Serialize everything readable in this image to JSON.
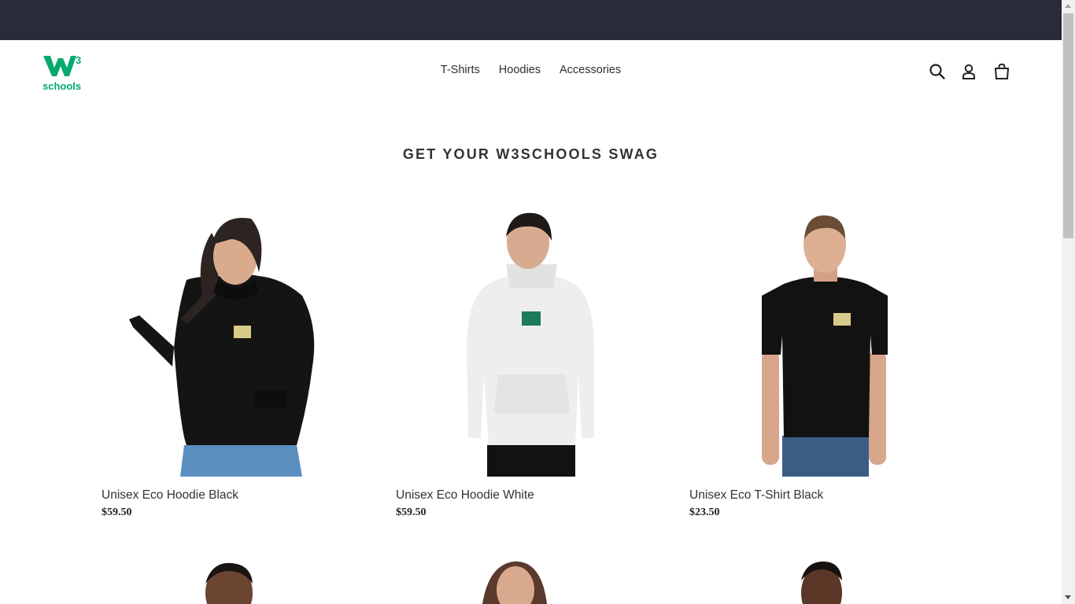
{
  "brand": {
    "logo_text": "schools",
    "logo_sup": "3",
    "accent": "#04aa6d"
  },
  "colors": {
    "topbar": "#282b39"
  },
  "nav": {
    "items": [
      {
        "label": "T-Shirts"
      },
      {
        "label": "Hoodies"
      },
      {
        "label": "Accessories"
      }
    ]
  },
  "header_icons": [
    "search-icon",
    "account-icon",
    "cart-icon"
  ],
  "main": {
    "heading": "GET YOUR W3SCHOOLS SWAG",
    "products": [
      {
        "title": "Unisex Eco Hoodie Black",
        "price": "$59.50",
        "garment": "hoodie",
        "garment_color": "black"
      },
      {
        "title": "Unisex Eco Hoodie White",
        "price": "$59.50",
        "garment": "hoodie",
        "garment_color": "white"
      },
      {
        "title": "Unisex Eco T-Shirt Black",
        "price": "$23.50",
        "garment": "t-shirt",
        "garment_color": "black"
      }
    ]
  }
}
